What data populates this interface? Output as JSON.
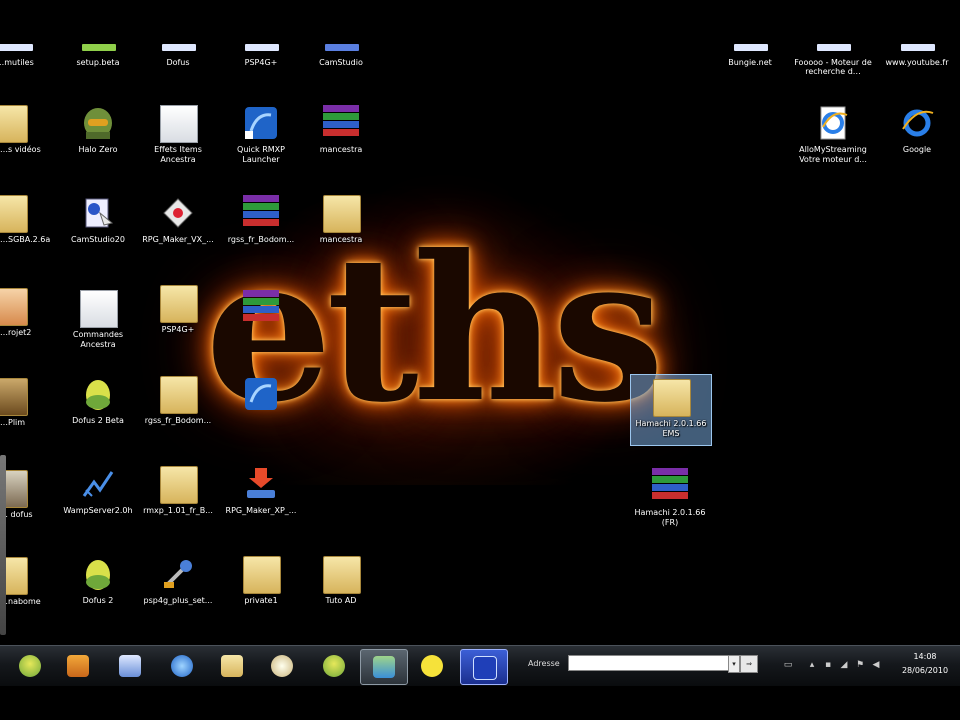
{
  "desktop": {
    "wallpaper_text": "eths",
    "top_row": [
      {
        "label": "…mutiles"
      },
      {
        "label": "setup.beta"
      },
      {
        "label": "Dofus"
      },
      {
        "label": "PSP4G+"
      },
      {
        "label": "CamStudio"
      },
      {
        "label": "Bungie.net"
      },
      {
        "label": "Fooooo - Moteur de recherche d…"
      },
      {
        "label": "www.youtube.fr"
      }
    ],
    "left_partial": [
      {
        "label": "…s vidéos"
      },
      {
        "label": "…SGBA.2.6a"
      },
      {
        "label": "…rojet2"
      },
      {
        "label": "…Plim"
      },
      {
        "label": "… dofus"
      },
      {
        "label": "…nabome"
      }
    ],
    "icons": {
      "halo_zero": "Halo Zero",
      "effets_items": "Effets Items Ancestra",
      "quick_rmxp": "Quick RMXP Launcher",
      "mancestra_rar": "mancestra",
      "camstudio20": "CamStudio20",
      "rpg_maker_vx": "RPG_Maker_VX_...",
      "rgss_rar": "rgss_fr_Bodom...",
      "mancestra_folder": "mancestra",
      "commandes": "Commandes Ancestra",
      "psp4g_folder": "PSP4G+",
      "dofus2beta": "Dofus 2 Beta",
      "rgss_folder": "rgss_fr_Bodom...",
      "wampserver": "WampServer2.0h",
      "rmxp_folder": "rmxp_1.01_fr_B...",
      "rpg_maker_xp": "RPG_Maker_XP_...",
      "dofus2": "Dofus 2",
      "psp4g_plus": "psp4g_plus_set...",
      "private": "private1",
      "tuto": "Tuto AD",
      "hamachi_folder": "Hamachi 2.0.1.66 EMS",
      "hamachi_rar": "Hamachi 2.0.1.66 (FR)",
      "allomystreaming": "AlloMyStreaming Votre moteur d...",
      "google": "Google"
    }
  },
  "taskbar": {
    "address_label": "Adresse",
    "address_value": "",
    "dropdown_glyph": "▾",
    "go_label": "⇒",
    "clock_time": "14:08",
    "clock_date": "28/06/2010",
    "buttons": [
      "dofus-egg",
      "media-player",
      "camstudio",
      "browser-globe",
      "explorer-folder",
      "paint",
      "dofus-egg-2",
      "network-users",
      "pacman",
      "rmxp-launcher"
    ]
  },
  "colors": {
    "fire_glow": "#ff6a00",
    "taskbar_top": "#2a2f35",
    "selection": "#78aadc"
  }
}
